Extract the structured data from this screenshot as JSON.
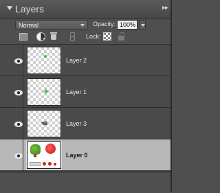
{
  "panel": {
    "title": "Layers",
    "menu_glyph": "▸▸"
  },
  "controls": {
    "blend_mode": "Normal",
    "opacity_label": "Opacity:",
    "opacity_value": "100%",
    "lock_label": "Lock:"
  },
  "icons": {
    "new_layer": "new-layer-icon",
    "adjustment": "adjustment-layer-icon",
    "delete": "trash-icon",
    "link": "link-icon",
    "lock_transparent": "lock-transparency-icon",
    "lock_all": "lock-icon"
  },
  "layers": [
    {
      "name": "Layer 2",
      "visible": true,
      "selected": false
    },
    {
      "name": "Layer 1",
      "visible": true,
      "selected": false
    },
    {
      "name": "Layer 3",
      "visible": true,
      "selected": false
    },
    {
      "name": "Layer 0",
      "visible": true,
      "selected": true
    }
  ],
  "colors": {
    "panel_bg": "#4f4f4f",
    "selected_row": "#b8b8b8",
    "text": "#e8e8e8"
  }
}
